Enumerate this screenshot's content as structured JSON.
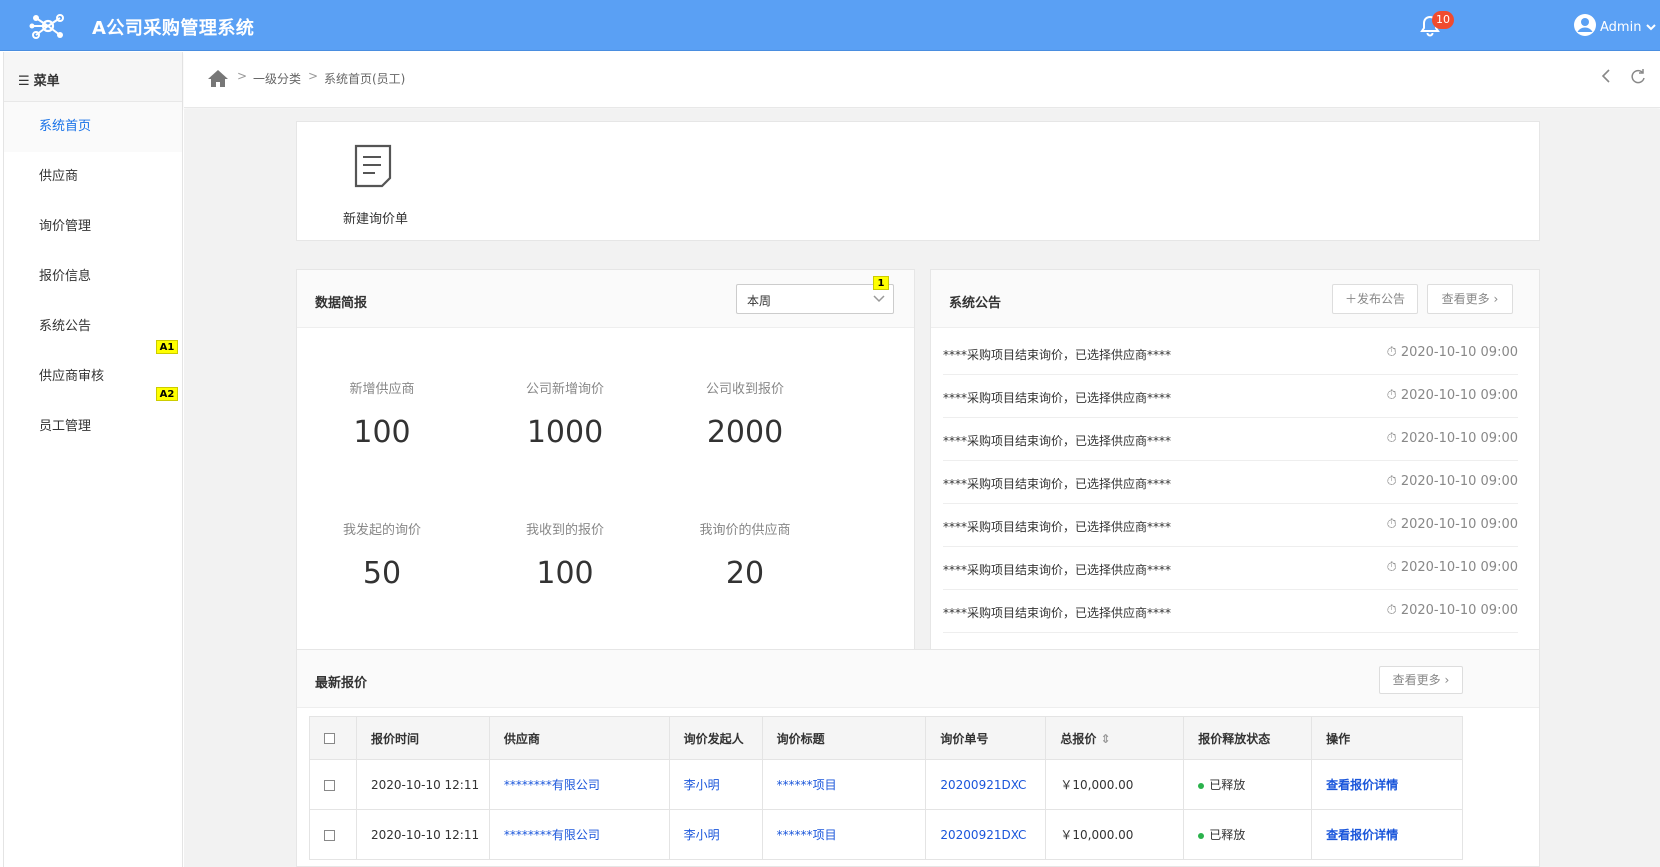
{
  "header": {
    "app_title": "A公司采购管理系统",
    "notification_count": "10",
    "user_name": "Admin"
  },
  "sidebar": {
    "menu_label": "菜单",
    "items": [
      {
        "label": "系统首页"
      },
      {
        "label": "供应商"
      },
      {
        "label": "询价管理"
      },
      {
        "label": "报价信息"
      },
      {
        "label": "系统公告"
      },
      {
        "label": "供应商审核"
      },
      {
        "label": "员工管理"
      }
    ],
    "tags": [
      "A1",
      "A2"
    ]
  },
  "breadcrumb": {
    "level1": "一级分类",
    "level2": "系统首页(员工)"
  },
  "quick_actions": {
    "new_inquiry_label": "新建询价单"
  },
  "stats": {
    "title": "数据简报",
    "period_value": "本周",
    "period_tag": "1",
    "items": [
      {
        "label": "新增供应商",
        "value": "100"
      },
      {
        "label": "公司新增询价",
        "value": "1000"
      },
      {
        "label": "公司收到报价",
        "value": "2000"
      },
      {
        "label": "我发起的询价",
        "value": "50"
      },
      {
        "label": "我收到的报价",
        "value": "100"
      },
      {
        "label": "我询价的供应商",
        "value": "20"
      }
    ]
  },
  "notice": {
    "title": "系统公告",
    "publish_label": "发布公告",
    "more_label": "查看更多",
    "items": [
      {
        "text": "****采购项目结束询价，已选择供应商****",
        "time": "2020-10-10 09:00"
      },
      {
        "text": "****采购项目结束询价，已选择供应商****",
        "time": "2020-10-10 09:00"
      },
      {
        "text": "****采购项目结束询价，已选择供应商****",
        "time": "2020-10-10 09:00"
      },
      {
        "text": "****采购项目结束询价，已选择供应商****",
        "time": "2020-10-10 09:00"
      },
      {
        "text": "****采购项目结束询价，已选择供应商****",
        "time": "2020-10-10 09:00"
      },
      {
        "text": "****采购项目结束询价，已选择供应商****",
        "time": "2020-10-10 09:00"
      },
      {
        "text": "****采购项目结束询价，已选择供应商****",
        "time": "2020-10-10 09:00"
      }
    ]
  },
  "quotes": {
    "title": "最新报价",
    "more_label": "查看更多",
    "columns": [
      "报价时间",
      "供应商",
      "询价发起人",
      "询价标题",
      "询价单号",
      "总报价",
      "报价释放状态",
      "操作"
    ],
    "rows": [
      {
        "time": "2020-10-10 12:11",
        "supplier": "********有限公司",
        "initiator": "李小明",
        "title": "******项目",
        "order_no": "20200921DXC",
        "total": "￥10,000.00",
        "status": "已释放",
        "action": "查看报价详情"
      },
      {
        "time": "2020-10-10 12:11",
        "supplier": "********有限公司",
        "initiator": "李小明",
        "title": "******项目",
        "order_no": "20200921DXC",
        "total": "￥10,000.00",
        "status": "已释放",
        "action": "查看报价详情"
      }
    ]
  },
  "colors": {
    "header_bg": "#5aa0f4",
    "link": "#1a56db",
    "active_menu": "#1a73e8",
    "status_green": "#2bb24c",
    "badge_red": "#f04b2f"
  }
}
